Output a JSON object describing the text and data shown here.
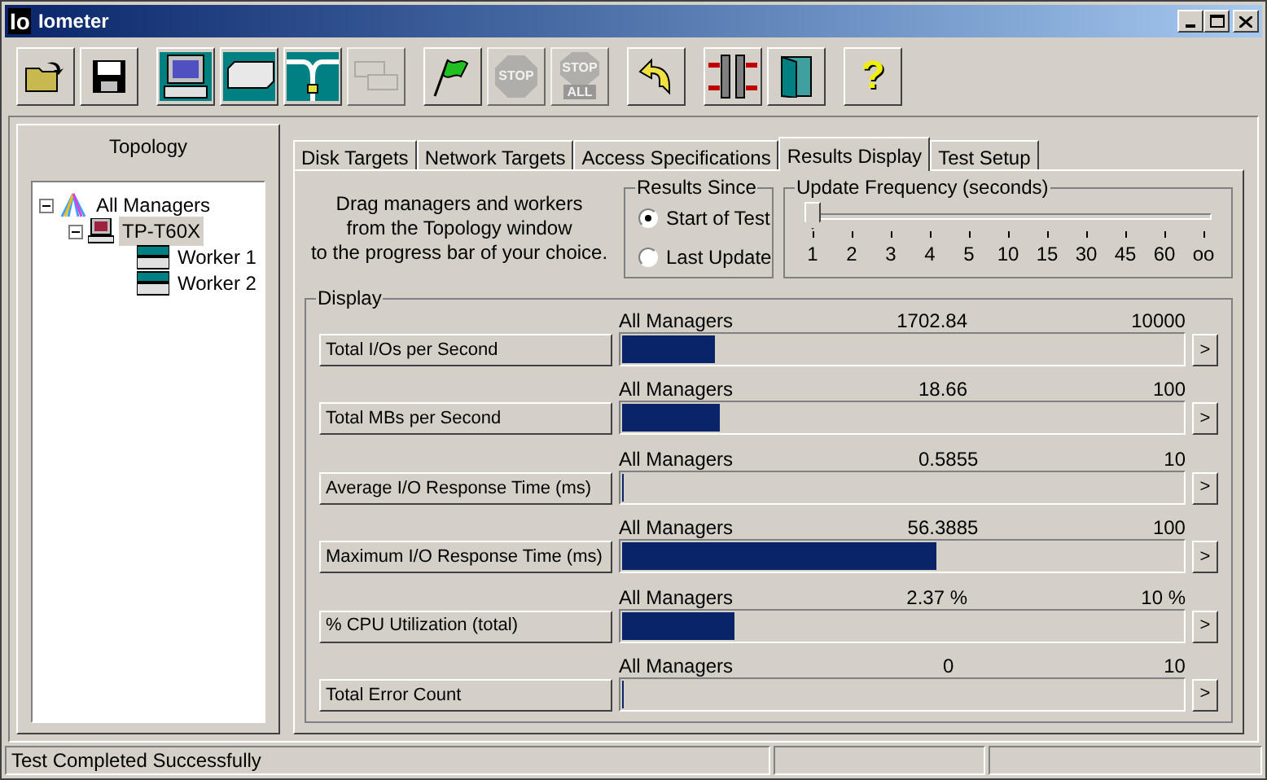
{
  "window": {
    "logo": "Io",
    "title": "Iometer"
  },
  "toolbar": [
    {
      "kind": "open",
      "disabled": false
    },
    {
      "kind": "save",
      "disabled": false
    },
    {
      "kind": "computer",
      "disabled": false
    },
    {
      "kind": "disk",
      "disabled": false
    },
    {
      "kind": "network",
      "disabled": false
    },
    {
      "kind": "copy",
      "disabled": true
    },
    {
      "kind": "flag",
      "disabled": false
    },
    {
      "kind": "stop",
      "text": "STOP",
      "disabled": true
    },
    {
      "kind": "stopall",
      "text": "STOP",
      "text2": "ALL",
      "disabled": true
    },
    {
      "kind": "reset",
      "disabled": false
    },
    {
      "kind": "disconnect",
      "disabled": false
    },
    {
      "kind": "exit",
      "disabled": false
    },
    {
      "kind": "help",
      "text": "?",
      "disabled": false
    }
  ],
  "topology": {
    "title": "Topology",
    "tree": [
      {
        "label": "All Managers",
        "kind": "managers",
        "expanded": true,
        "selected": false,
        "children": [
          {
            "label": "TP-T60X",
            "kind": "manager",
            "expanded": true,
            "selected": true,
            "children": [
              {
                "label": "Worker 1",
                "kind": "worker",
                "selected": false
              },
              {
                "label": "Worker 2",
                "kind": "worker",
                "selected": false
              }
            ]
          }
        ]
      }
    ]
  },
  "tabs": [
    {
      "label": "Disk Targets",
      "selected": false
    },
    {
      "label": "Network Targets",
      "selected": false
    },
    {
      "label": "Access Specifications",
      "selected": false
    },
    {
      "label": "Results Display",
      "selected": true
    },
    {
      "label": "Test Setup",
      "selected": false
    }
  ],
  "instructions": [
    "Drag managers and workers",
    "from the Topology window",
    "to the progress bar of your choice."
  ],
  "results_since": {
    "title": "Results Since",
    "options": [
      {
        "label": "Start of Test",
        "selected": true
      },
      {
        "label": "Last Update",
        "selected": false
      }
    ]
  },
  "update_frequency": {
    "title": "Update Frequency (seconds)",
    "level": 0,
    "ticks": [
      "1",
      "2",
      "3",
      "4",
      "5",
      "10",
      "15",
      "30",
      "45",
      "60",
      "oo"
    ]
  },
  "display": {
    "title": "Display",
    "rows": [
      {
        "label": "Total I/Os per Second",
        "source": "All Managers",
        "value": "1702.84",
        "max": "10000",
        "level": 0.165,
        "more": ">"
      },
      {
        "label": "Total MBs per Second",
        "source": "All Managers",
        "value": "18.66",
        "max": "100",
        "level": 0.175,
        "more": ">"
      },
      {
        "label": "Average I/O Response Time (ms)",
        "source": "All Managers",
        "value": "0.5855",
        "max": "10",
        "level": 0,
        "more": ">"
      },
      {
        "label": "Maximum I/O Response Time (ms)",
        "source": "All Managers",
        "value": "56.3885",
        "max": "100",
        "level": 0.56,
        "more": ">"
      },
      {
        "label": "% CPU Utilization (total)",
        "source": "All Managers",
        "value": "2.37 %",
        "max": "10 %",
        "level": 0.2,
        "more": ">"
      },
      {
        "label": "Total Error Count",
        "source": "All Managers",
        "value": "0",
        "max": "10",
        "level": 0,
        "more": ">"
      }
    ]
  },
  "status_bar": {
    "text": "Test Completed Successfully"
  }
}
